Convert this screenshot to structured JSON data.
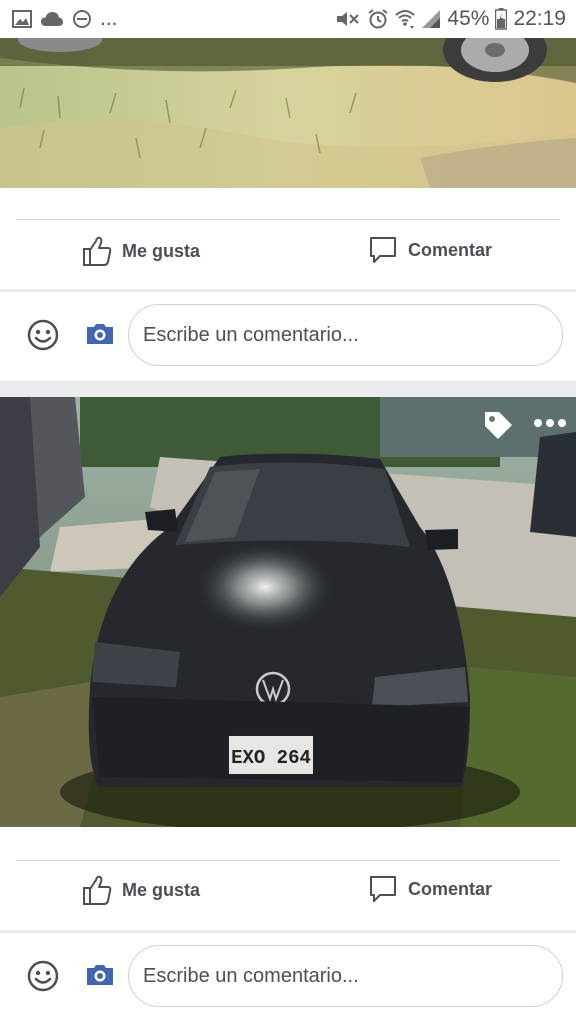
{
  "status_bar": {
    "left_icons": [
      "image-icon",
      "cloud-icon",
      "do-not-disturb-icon"
    ],
    "more_indicator": "...",
    "right_icons": [
      "mute-icon",
      "alarm-icon",
      "wifi-icon",
      "signal-icon"
    ],
    "battery_percent": "45%",
    "time": "22:19"
  },
  "posts": [
    {
      "photo_description_icon": "car-wheel-on-grass-photo",
      "actions": {
        "like_label": "Me gusta",
        "comment_label": "Comentar"
      },
      "comment_placeholder": "Escribe un comentario..."
    },
    {
      "photo_description_icon": "black-vw-car-photo",
      "plate_text": "EXO 264",
      "overlay_icons": [
        "tag-icon",
        "more-options-icon"
      ],
      "actions": {
        "like_label": "Me gusta",
        "comment_label": "Comentar"
      },
      "comment_placeholder": "Escribe un comentario..."
    }
  ],
  "colors": {
    "icon_gray": "#4b4f56",
    "camera_blue": "#4267b2",
    "divider": "#d5d7da",
    "background": "#e9ebee"
  }
}
